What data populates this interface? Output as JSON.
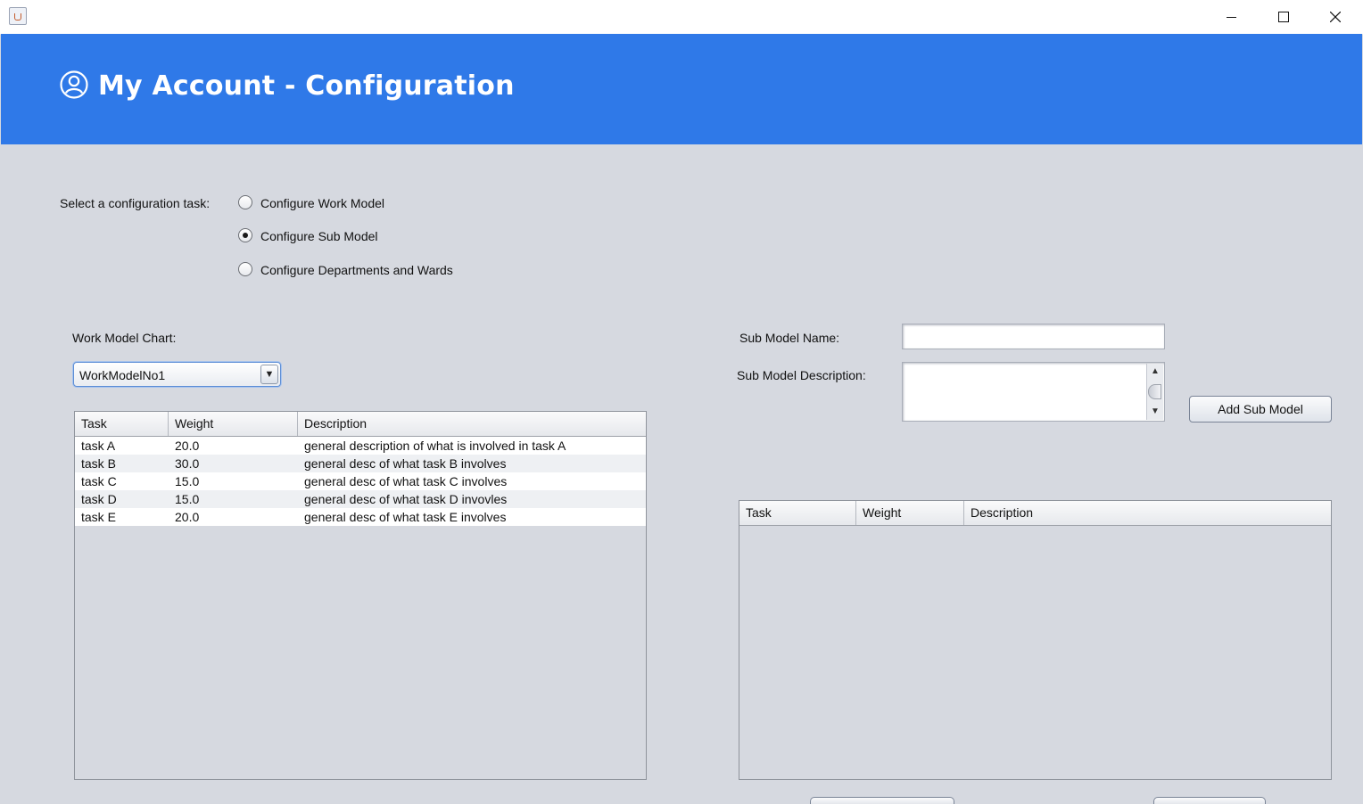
{
  "window": {
    "app_icon": "java-cup-icon",
    "controls": [
      "minimize-icon",
      "maximize-icon",
      "close-icon"
    ]
  },
  "header": {
    "title": "My Account - Configuration",
    "icon": "user-circle-icon",
    "background": "#2f79e8"
  },
  "config": {
    "label": "Select a configuration task:",
    "options": [
      {
        "label": "Configure Work Model",
        "checked": false
      },
      {
        "label": "Configure Sub Model",
        "checked": true
      },
      {
        "label": "Configure Departments and Wards",
        "checked": false
      }
    ]
  },
  "work_model": {
    "label": "Work Model Chart:",
    "selected": "WorkModelNo1",
    "columns": [
      "Task",
      "Weight",
      "Description"
    ],
    "rows": [
      [
        "task A",
        "20.0",
        "general description of what is involved in task A"
      ],
      [
        "task B",
        "30.0",
        "general desc of what task B involves"
      ],
      [
        "task C",
        "15.0",
        "general desc of what task C involves"
      ],
      [
        "task D",
        "15.0",
        "general desc of what task D invovles"
      ],
      [
        "task E",
        "20.0",
        "general desc of what task E involves"
      ]
    ]
  },
  "sub_model": {
    "name_label": "Sub Model Name:",
    "name_value": "",
    "description_label": "Sub Model Description:",
    "description_value": "",
    "add_button": "Add Sub Model",
    "columns": [
      "Task",
      "Weight",
      "Description"
    ],
    "rows": []
  }
}
